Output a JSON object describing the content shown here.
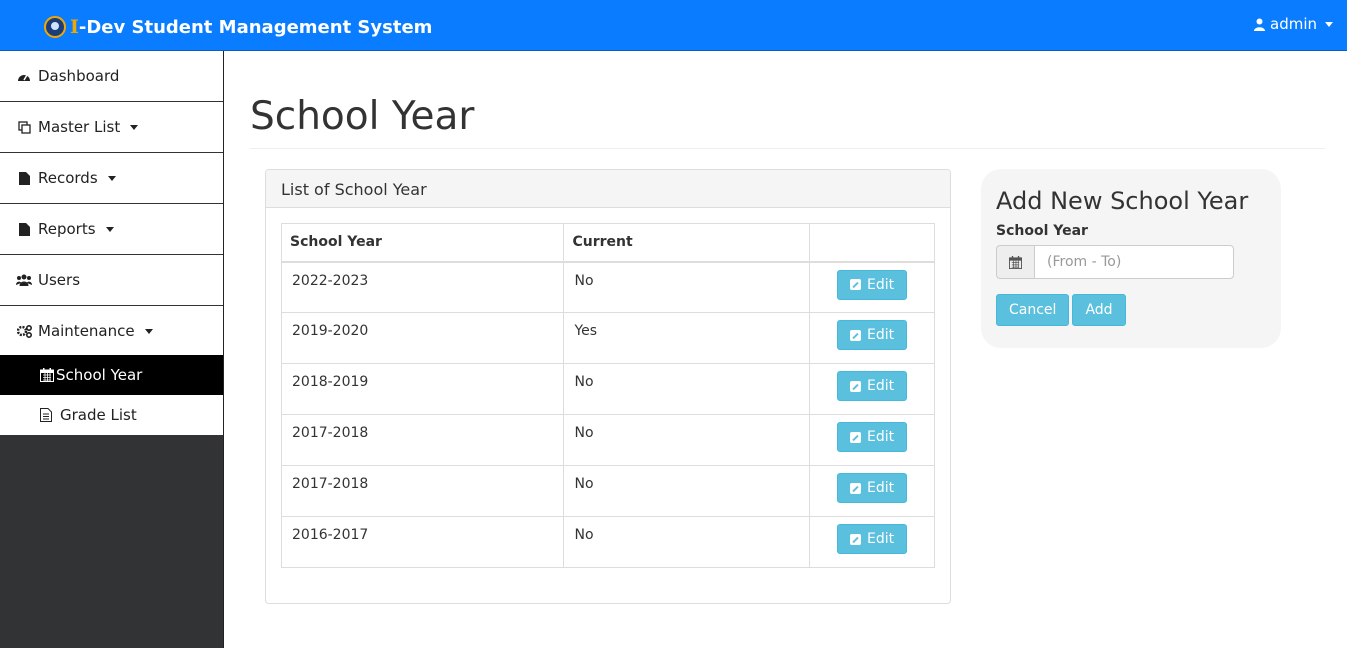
{
  "navbar": {
    "brand_initial": "I",
    "brand_text": "-Dev Student Management System",
    "user_label": "admin"
  },
  "sidebar": {
    "items": [
      {
        "label": "Dashboard",
        "icon": "dashboard-icon"
      },
      {
        "label": "Master List",
        "icon": "copy-icon"
      },
      {
        "label": "Records",
        "icon": "file-icon"
      },
      {
        "label": "Reports",
        "icon": "file-icon"
      },
      {
        "label": "Users",
        "icon": "users-icon"
      },
      {
        "label": "Maintenance",
        "icon": "cogs-icon"
      }
    ],
    "subitems": [
      {
        "label": "School Year",
        "icon": "calendar-icon",
        "active": true
      },
      {
        "label": "Grade List",
        "icon": "document-icon",
        "active": false
      }
    ]
  },
  "main": {
    "title": "School Year",
    "panel": {
      "heading": "List of School Year",
      "columns": [
        "School Year",
        "Current",
        ""
      ],
      "rows": [
        {
          "year": "2022-2023",
          "current": "No",
          "action": "Edit"
        },
        {
          "year": "2019-2020",
          "current": "Yes",
          "action": "Edit"
        },
        {
          "year": "2018-2019",
          "current": "No",
          "action": "Edit"
        },
        {
          "year": "2017-2018",
          "current": "No",
          "action": "Edit"
        },
        {
          "year": "2017-2018",
          "current": "No",
          "action": "Edit"
        },
        {
          "year": "2016-2017",
          "current": "No",
          "action": "Edit"
        }
      ]
    },
    "add_form": {
      "title": "Add New School Year",
      "field_label": "School Year",
      "placeholder": "(From - To)",
      "cancel_label": "Cancel",
      "add_label": "Add"
    }
  },
  "colors": {
    "navbar": "#0a7cff",
    "brand_initial": "#f0a800",
    "button_info": "#5bc0de",
    "sidebar_dark": "#323335",
    "active_item": "#000000"
  }
}
